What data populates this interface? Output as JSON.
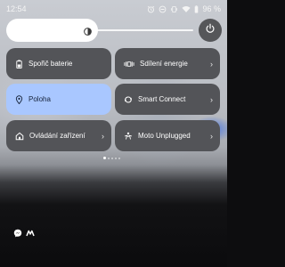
{
  "status_bar": {
    "time": "12:54",
    "battery_text": "96 %",
    "icons": [
      "alarm-icon",
      "do-not-disturb-icon",
      "vibrate-icon",
      "wifi-icon",
      "battery-icon"
    ]
  },
  "brightness": {
    "level_fraction": 0.47,
    "icon": "sun-icon"
  },
  "power_button": {
    "icon": "power-icon"
  },
  "tiles": {
    "battery_saver": {
      "label": "Spořič baterie",
      "icon": "battery-saver-icon",
      "state": "off"
    },
    "power_share": {
      "label": "Sdílení energie",
      "icon": "power-share-icon",
      "state": "off",
      "chevron": "›"
    },
    "location": {
      "label": "Poloha",
      "icon": "location-pin-icon",
      "state": "on"
    },
    "smart_connect": {
      "label": "Smart Connect",
      "icon": "smart-connect-icon",
      "state": "off",
      "chevron": "›"
    },
    "device_control": {
      "label": "Ovládání zařízení",
      "icon": "home-icon",
      "state": "off",
      "chevron": "›"
    },
    "moto_unplugged": {
      "label": "Moto Unplugged",
      "icon": "person-meditate-icon",
      "state": "off",
      "chevron": "›"
    }
  },
  "page_indicator": {
    "pages": 5,
    "active": 0
  },
  "notification_icons": [
    "messenger-icon",
    "app-m-icon"
  ],
  "colors": {
    "tile_dark": "#535458",
    "tile_active": "#a9c7ff",
    "power_button": "#555659"
  }
}
